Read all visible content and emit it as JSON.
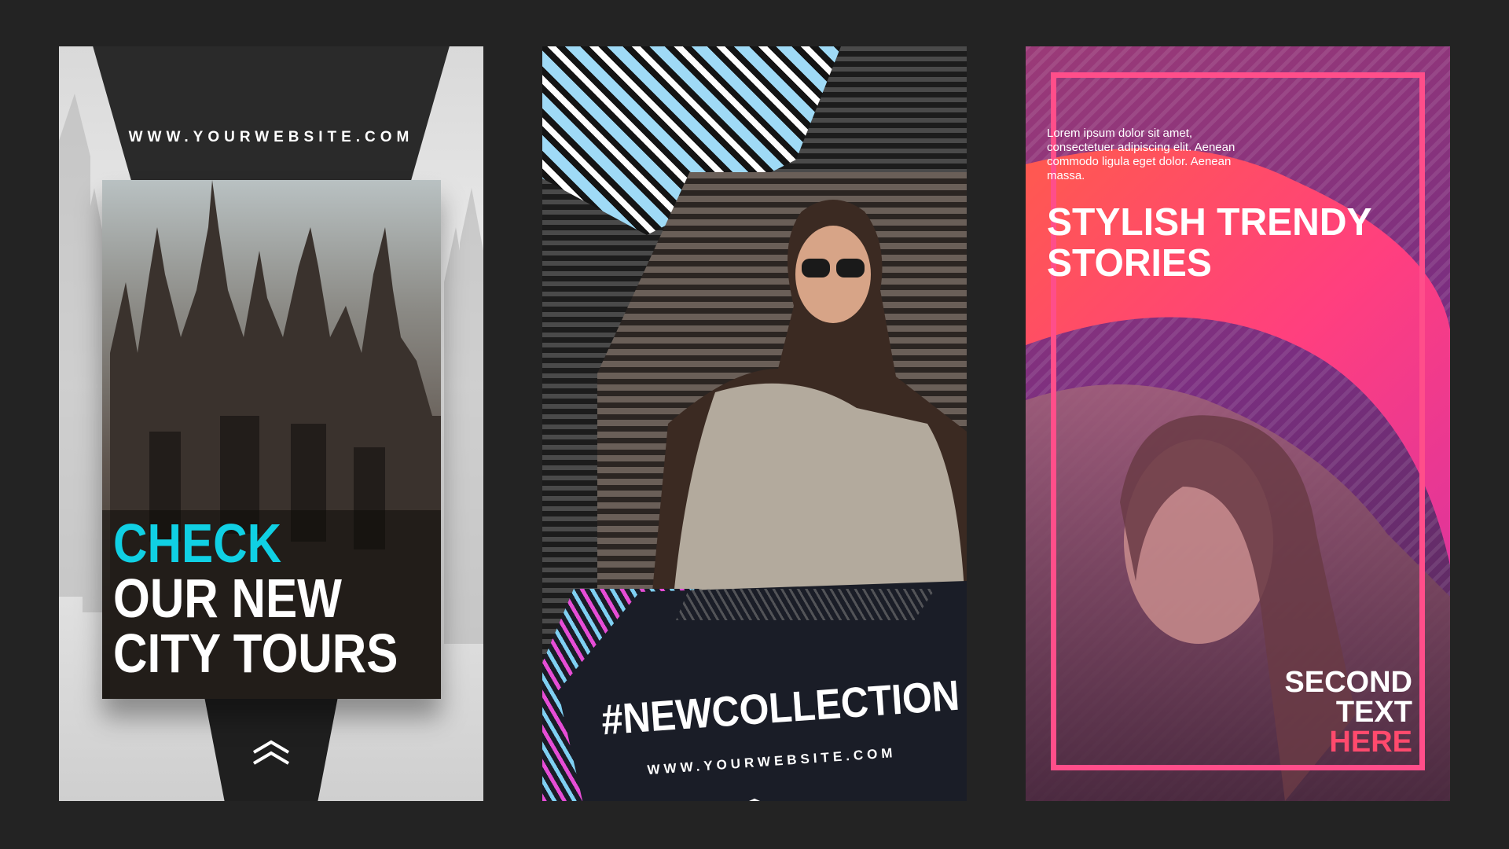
{
  "cards": [
    {
      "url": "WWW.YOURWEBSITE.COM",
      "headline": [
        "CHECK",
        "OUR NEW",
        "CITY TOURS"
      ],
      "accent": "#10d0e4",
      "icon": "double-chevron-up-icon"
    },
    {
      "tag": "#NEWCOLLECTION",
      "url": "WWW.YOURWEBSITE.COM",
      "accent": "#e64dd6",
      "icon": "chevron-up-icon"
    },
    {
      "body": "Lorem ipsum dolor sit amet, consectetuer adipiscing elit. Aenean commodo ligula eget dolor. Aenean massa.",
      "title": [
        "STYLISH TRENDY",
        "STORIES"
      ],
      "second": [
        "SECOND",
        "TEXT",
        "HERE"
      ],
      "accent": "#ff4a6d"
    }
  ]
}
